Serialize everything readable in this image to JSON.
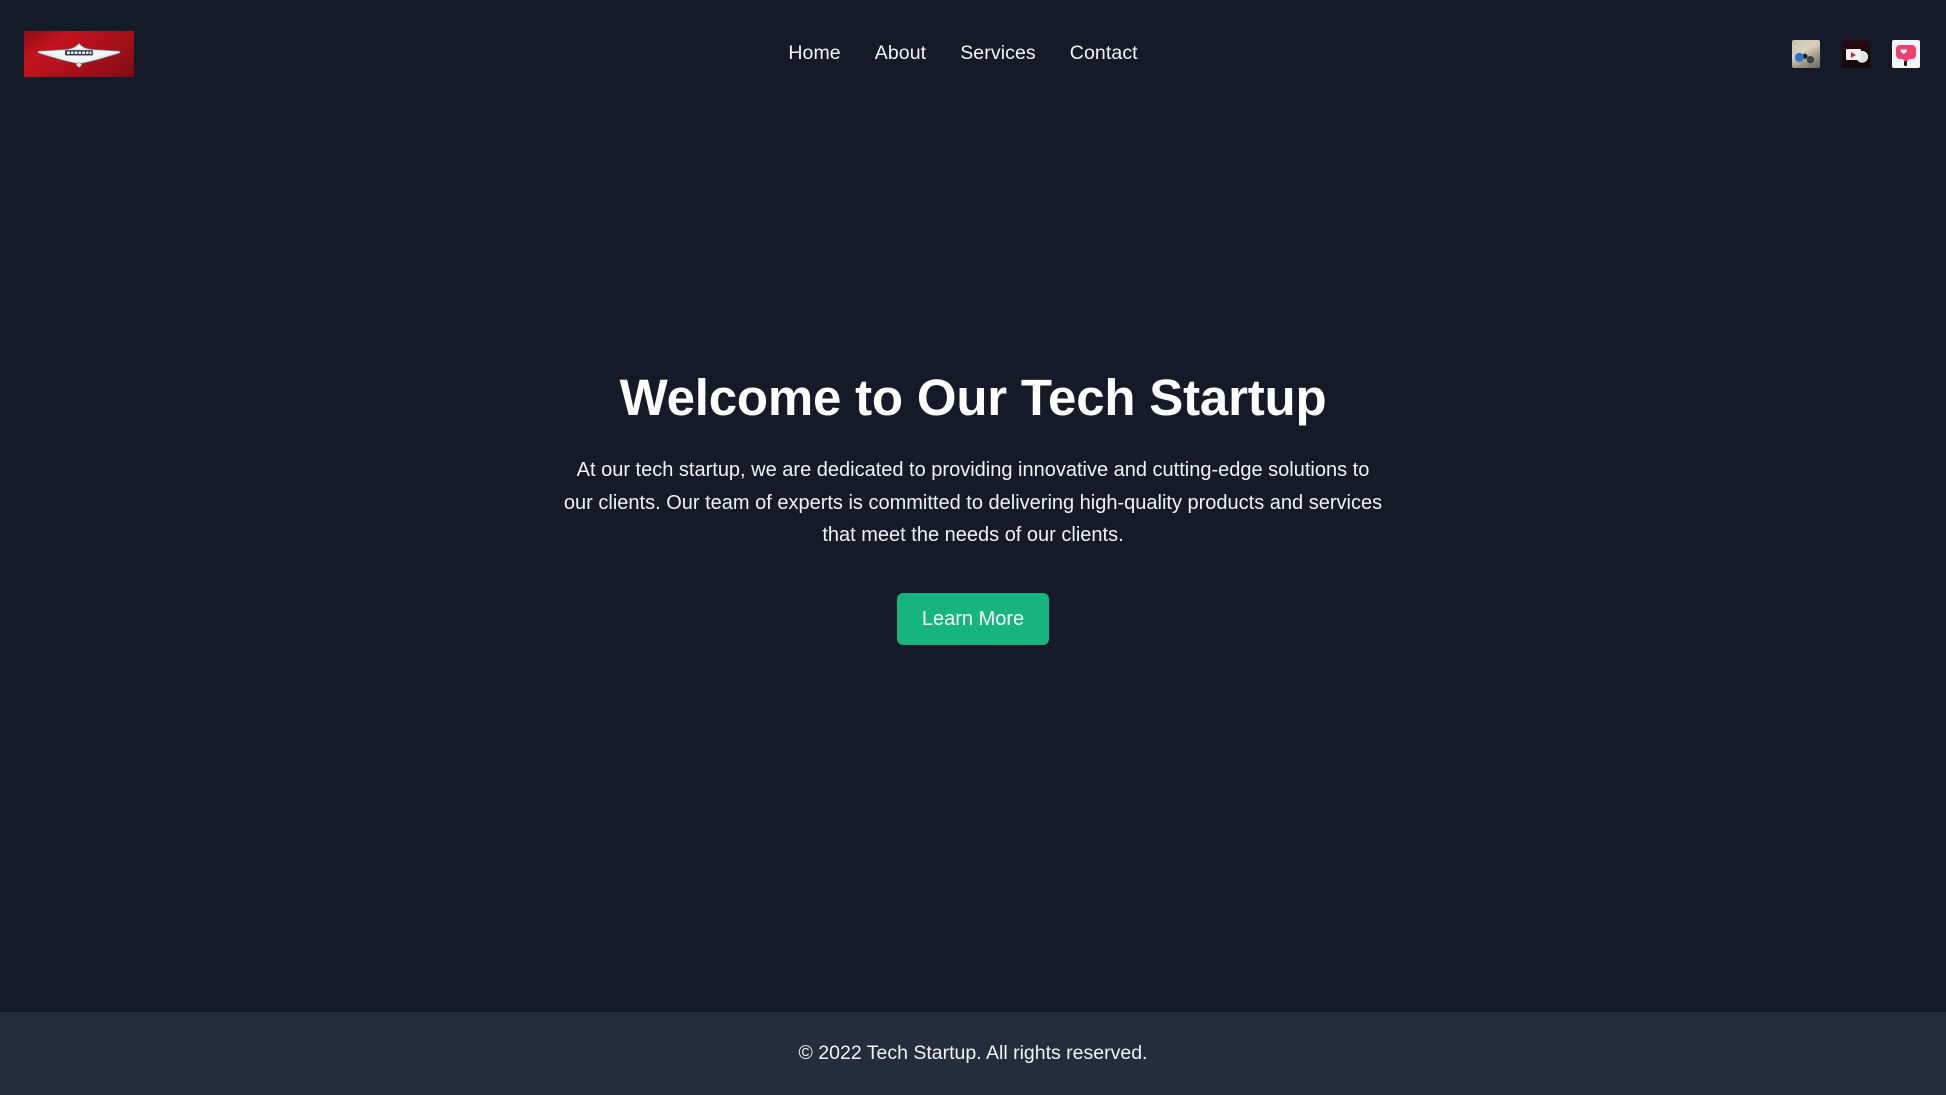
{
  "site": {
    "background_color": "#141a27",
    "accent_color": "#16b47f",
    "footer_background_color": "#242d3c"
  },
  "header": {
    "logo": {
      "name": "brand-logo",
      "alt": "Tech Startup winged emblem logo",
      "background_color": "#b01119"
    },
    "nav": [
      {
        "label": "Home"
      },
      {
        "label": "About"
      },
      {
        "label": "Services"
      },
      {
        "label": "Contact"
      }
    ],
    "social": [
      {
        "name": "social-icon-photo",
        "label": ""
      },
      {
        "name": "social-icon-media",
        "label": ""
      },
      {
        "name": "social-icon-heart-bubble",
        "label": ""
      }
    ]
  },
  "hero": {
    "title": "Welcome to Our Tech Startup",
    "paragraph": "At our tech startup, we are dedicated to providing innovative and cutting-edge solutions to our clients. Our team of experts is committed to delivering high-quality products and services that meet the needs of our clients.",
    "cta_label": "Learn More"
  },
  "footer": {
    "copyright": "© 2022 Tech Startup. All rights reserved."
  }
}
